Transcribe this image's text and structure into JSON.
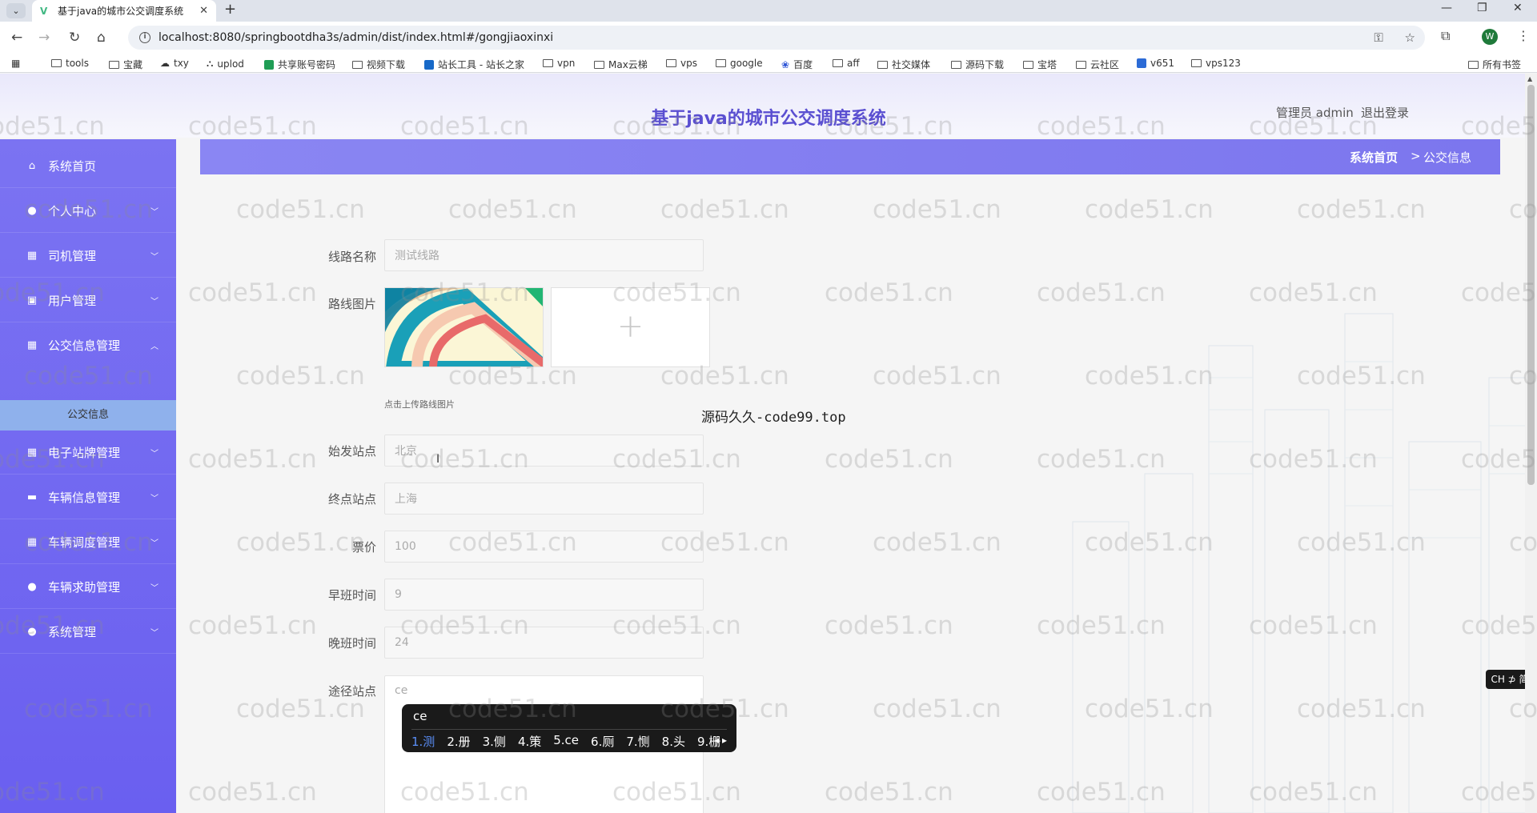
{
  "browser": {
    "tab_title": "基于java的城市公交调度系统",
    "url": "localhost:8080/springbootdha3s/admin/dist/index.html#/gongjiaoxinxi",
    "profile_initial": "W",
    "bookmarks": [
      "tools",
      "宝藏",
      "txy",
      "uplod",
      "共享账号密码",
      "视频下载",
      "站长工具 - 站长之家",
      "vpn",
      "Max云梯",
      "vps",
      "google",
      "百度",
      "aff",
      "社交媒体",
      "源码下载",
      "宝塔",
      "云社区",
      "v651",
      "vps123"
    ],
    "all_bookmarks": "所有书签"
  },
  "header": {
    "title": "基于java的城市公交调度系统",
    "user": "管理员 admin",
    "logout": "退出登录"
  },
  "sidebar": {
    "items": [
      {
        "label": "系统首页",
        "icon": "home-icon"
      },
      {
        "label": "个人中心",
        "icon": "user-icon"
      },
      {
        "label": "司机管理",
        "icon": "grid-icon"
      },
      {
        "label": "用户管理",
        "icon": "clipboard-icon"
      },
      {
        "label": "公交信息管理",
        "icon": "grid-icon"
      },
      {
        "label": "电子站牌管理",
        "icon": "grid-icon"
      },
      {
        "label": "车辆信息管理",
        "icon": "ticket-icon"
      },
      {
        "label": "车辆调度管理",
        "icon": "grid-icon"
      },
      {
        "label": "车辆求助管理",
        "icon": "bulb-icon"
      },
      {
        "label": "系统管理",
        "icon": "user-icon"
      }
    ],
    "subitem": "公交信息"
  },
  "breadcrumb": {
    "home": "系统首页",
    "separator": ">",
    "current": "公交信息"
  },
  "form": {
    "route_name": {
      "label": "线路名称",
      "placeholder": "测试线路"
    },
    "route_image": {
      "label": "路线图片",
      "hint": "点击上传路线图片"
    },
    "start_station": {
      "label": "始发站点",
      "placeholder": "北京"
    },
    "end_station": {
      "label": "终点站点",
      "placeholder": "上海"
    },
    "fare": {
      "label": "票价",
      "placeholder": "100"
    },
    "morning_shift": {
      "label": "早班时间",
      "placeholder": "9"
    },
    "evening_shift": {
      "label": "晚班时间",
      "placeholder": "24"
    },
    "via_stations": {
      "label": "途径站点",
      "value": "ce"
    }
  },
  "source_note": "源码久久-code99.top",
  "ime": {
    "composition": "ce",
    "candidates": [
      "1.测",
      "2.册",
      "3.侧",
      "4.策",
      "5.ce",
      "6.厕",
      "7.恻",
      "8.头",
      "9.栅"
    ]
  },
  "ime_badge": "CH ⊅ 简",
  "watermark": "code51.cn"
}
